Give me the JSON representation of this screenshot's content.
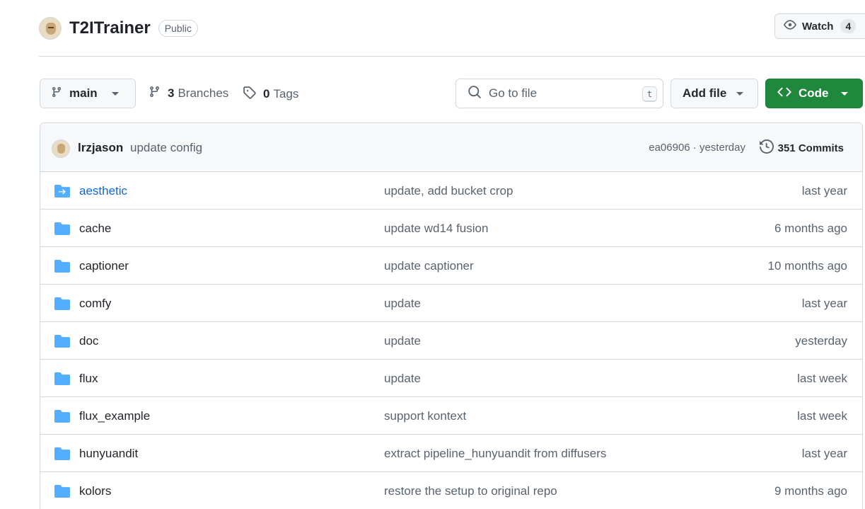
{
  "repo": {
    "name": "T2ITrainer",
    "visibility": "Public"
  },
  "watch": {
    "label": "Watch",
    "count": "4"
  },
  "toolbar": {
    "branch": "main",
    "branches_count": "3",
    "branches_label": "Branches",
    "tags_count": "0",
    "tags_label": "Tags",
    "search_placeholder": "Go to file",
    "search_shortcut": "t",
    "add_file_label": "Add file",
    "code_label": "Code"
  },
  "latest_commit": {
    "author": "lrzjason",
    "message": "update config",
    "hash_time": "ea06906 · yesterday",
    "commits_label": "351 Commits"
  },
  "files": [
    {
      "name": "aesthetic",
      "message": "update, add bucket crop",
      "date": "last year",
      "type": "submodule"
    },
    {
      "name": "cache",
      "message": "update wd14 fusion",
      "date": "6 months ago",
      "type": "folder"
    },
    {
      "name": "captioner",
      "message": "update captioner",
      "date": "10 months ago",
      "type": "folder"
    },
    {
      "name": "comfy",
      "message": "update",
      "date": "last year",
      "type": "folder"
    },
    {
      "name": "doc",
      "message": "update",
      "date": "yesterday",
      "type": "folder"
    },
    {
      "name": "flux",
      "message": "update",
      "date": "last week",
      "type": "folder"
    },
    {
      "name": "flux_example",
      "message": "support kontext",
      "date": "last week",
      "type": "folder"
    },
    {
      "name": "hunyuandit",
      "message": "extract pipeline_hunyuandit from diffusers",
      "date": "last year",
      "type": "folder"
    },
    {
      "name": "kolors",
      "message": "restore the setup to original repo",
      "date": "9 months ago",
      "type": "folder"
    }
  ],
  "colors": {
    "accent": "#0969da",
    "code_button": "#1f883d",
    "folder_icon": "#54aeff"
  }
}
